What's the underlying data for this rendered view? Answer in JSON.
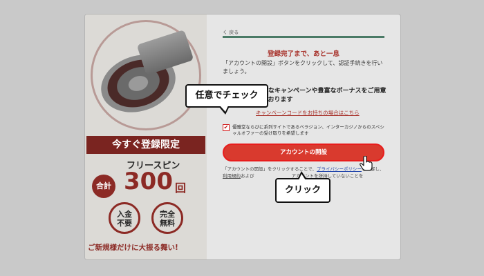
{
  "promo": {
    "banner": "今すぐ登録限定",
    "free_spins": "フリースピン",
    "total_badge": "合計",
    "count": "300",
    "count_unit": "回",
    "no_deposit": [
      "入金",
      "不要"
    ],
    "fully_free": [
      "完全",
      "無料"
    ],
    "tagline": "ご新規様だけに大振る舞い!"
  },
  "form": {
    "back": "く 戻る",
    "heading": "登録完了まで、あと一息",
    "description": "「アカウントの開設」ボタンをクリックして、認証手続きを行いましょう。",
    "promo_message": "多彩なキャンペーンや豊富なボーナスをご用意しております",
    "coupon_link": "キャンペーンコードをお持ちの場合はこちら",
    "optin_checked": true,
    "optin_text": "優雅堂ならびに系列サイトであるベラジョン、インターカジノからのスペシャルオファーの受け取りを希望します",
    "open_button": "アカウントの開設",
    "notice_pre": "「アカウントの開設」をクリックすることで、",
    "notice_privacy": "プライバシーポリシー",
    "notice_mid": "を理解し、",
    "notice_terms": "利用規約",
    "notice_post": "および 　　　　　　　　アカウントを所持していないことを"
  },
  "callouts": {
    "optional_check": "任意でチェック",
    "click": "クリック"
  },
  "colors": {
    "accent": "#d93a2e",
    "highlight_border": "#e81c1c",
    "progress": "#4a7a66",
    "brand_red": "#8c2a25"
  }
}
